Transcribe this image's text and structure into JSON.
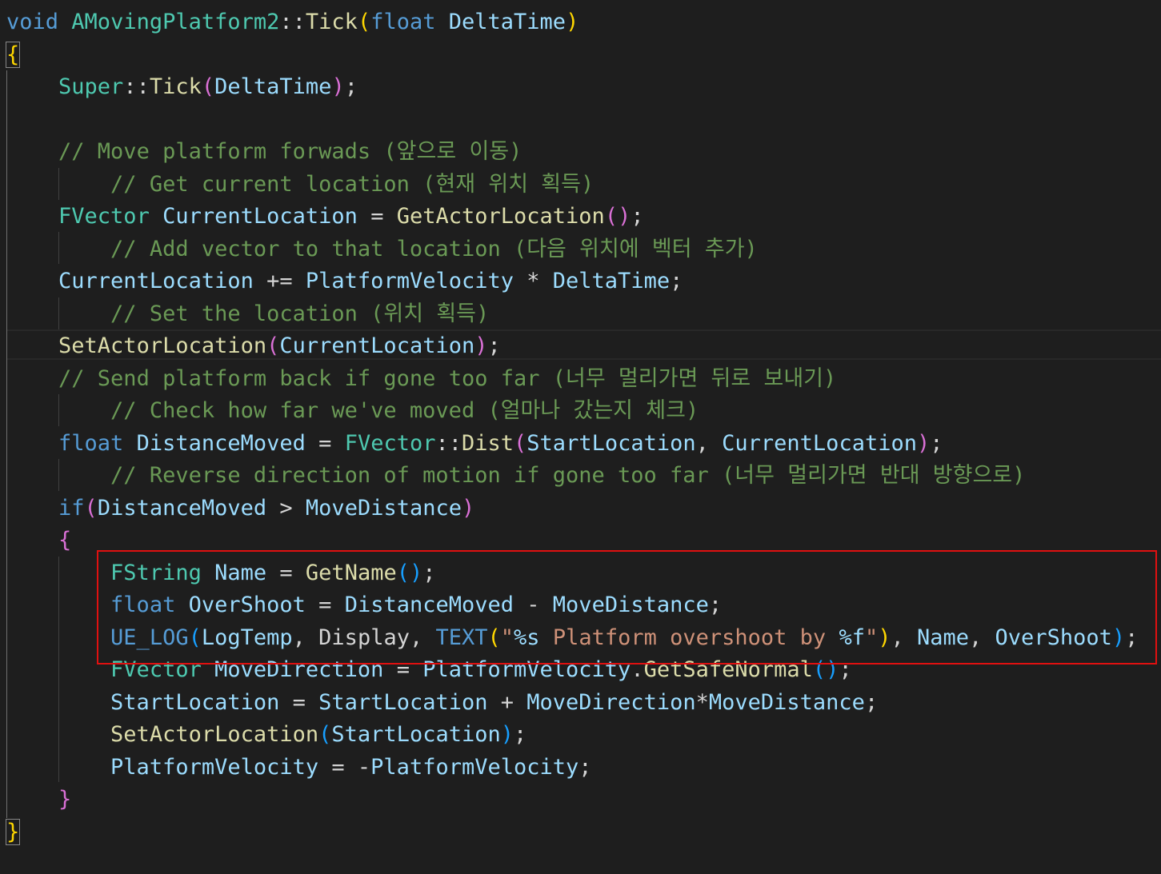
{
  "colors": {
    "background": "#1e1e1e",
    "keyword": "#569cd6",
    "type": "#4ec9b0",
    "function": "#dcdcaa",
    "variable": "#9cdcfe",
    "comment": "#6a9955",
    "string": "#ce9178",
    "macro": "#569cd6",
    "plain": "#d4d4d4",
    "bracket1": "#ffd700",
    "bracket2": "#da70d6",
    "bracket3": "#179fff",
    "highlight": "#e01010"
  },
  "code_lines": [
    [
      {
        "t": "void",
        "c": "keyword"
      },
      {
        "t": " ",
        "c": "plain"
      },
      {
        "t": "AMovingPlatform2",
        "c": "type"
      },
      {
        "t": "::",
        "c": "plain"
      },
      {
        "t": "Tick",
        "c": "function"
      },
      {
        "t": "(",
        "c": "bracket1"
      },
      {
        "t": "float",
        "c": "keyword"
      },
      {
        "t": " ",
        "c": "plain"
      },
      {
        "t": "DeltaTime",
        "c": "variable"
      },
      {
        "t": ")",
        "c": "bracket1"
      }
    ],
    [
      {
        "t": "{",
        "c": "bracket1",
        "box": true
      }
    ],
    [
      {
        "t": "    ",
        "c": "plain"
      },
      {
        "t": "Super",
        "c": "type"
      },
      {
        "t": "::",
        "c": "plain"
      },
      {
        "t": "Tick",
        "c": "function"
      },
      {
        "t": "(",
        "c": "bracket2"
      },
      {
        "t": "DeltaTime",
        "c": "variable"
      },
      {
        "t": ")",
        "c": "bracket2"
      },
      {
        "t": ";",
        "c": "plain"
      }
    ],
    [],
    [
      {
        "t": "    ",
        "c": "plain"
      },
      {
        "t": "// Move platform forwads (앞으로 이동)",
        "c": "comment"
      }
    ],
    [
      {
        "t": "        ",
        "c": "plain"
      },
      {
        "t": "// Get current location (현재 위치 획득)",
        "c": "comment"
      }
    ],
    [
      {
        "t": "    ",
        "c": "plain"
      },
      {
        "t": "FVector",
        "c": "type"
      },
      {
        "t": " ",
        "c": "plain"
      },
      {
        "t": "CurrentLocation",
        "c": "variable"
      },
      {
        "t": " = ",
        "c": "plain"
      },
      {
        "t": "GetActorLocation",
        "c": "function"
      },
      {
        "t": "(",
        "c": "bracket2"
      },
      {
        "t": ")",
        "c": "bracket2"
      },
      {
        "t": ";",
        "c": "plain"
      }
    ],
    [
      {
        "t": "        ",
        "c": "plain"
      },
      {
        "t": "// Add vector to that location (다음 위치에 벡터 추가)",
        "c": "comment"
      }
    ],
    [
      {
        "t": "    ",
        "c": "plain"
      },
      {
        "t": "CurrentLocation",
        "c": "variable"
      },
      {
        "t": " += ",
        "c": "plain"
      },
      {
        "t": "PlatformVelocity",
        "c": "variable"
      },
      {
        "t": " * ",
        "c": "plain"
      },
      {
        "t": "DeltaTime",
        "c": "variable"
      },
      {
        "t": ";",
        "c": "plain"
      }
    ],
    [
      {
        "t": "        ",
        "c": "plain"
      },
      {
        "t": "// Set the location (위치 획득)",
        "c": "comment"
      }
    ],
    [
      {
        "t": "    ",
        "c": "plain"
      },
      {
        "t": "SetActorLocation",
        "c": "function"
      },
      {
        "t": "(",
        "c": "bracket2"
      },
      {
        "t": "CurrentLocation",
        "c": "variable"
      },
      {
        "t": ")",
        "c": "bracket2"
      },
      {
        "t": ";",
        "c": "plain"
      }
    ],
    [
      {
        "t": "    ",
        "c": "plain"
      },
      {
        "t": "// Send platform back if gone too far (너무 멀리가면 뒤로 보내기)",
        "c": "comment"
      }
    ],
    [
      {
        "t": "        ",
        "c": "plain"
      },
      {
        "t": "// Check how far we've moved (얼마나 갔는지 체크)",
        "c": "comment"
      }
    ],
    [
      {
        "t": "    ",
        "c": "plain"
      },
      {
        "t": "float",
        "c": "keyword"
      },
      {
        "t": " ",
        "c": "plain"
      },
      {
        "t": "DistanceMoved",
        "c": "variable"
      },
      {
        "t": " = ",
        "c": "plain"
      },
      {
        "t": "FVector",
        "c": "type"
      },
      {
        "t": "::",
        "c": "plain"
      },
      {
        "t": "Dist",
        "c": "function"
      },
      {
        "t": "(",
        "c": "bracket2"
      },
      {
        "t": "StartLocation",
        "c": "variable"
      },
      {
        "t": ", ",
        "c": "plain"
      },
      {
        "t": "CurrentLocation",
        "c": "variable"
      },
      {
        "t": ")",
        "c": "bracket2"
      },
      {
        "t": ";",
        "c": "plain"
      }
    ],
    [
      {
        "t": "        ",
        "c": "plain"
      },
      {
        "t": "// Reverse direction of motion if gone too far (너무 멀리가면 반대 방향으로)",
        "c": "comment"
      }
    ],
    [
      {
        "t": "    ",
        "c": "plain"
      },
      {
        "t": "if",
        "c": "keyword"
      },
      {
        "t": "(",
        "c": "bracket2"
      },
      {
        "t": "DistanceMoved",
        "c": "variable"
      },
      {
        "t": " > ",
        "c": "plain"
      },
      {
        "t": "MoveDistance",
        "c": "variable"
      },
      {
        "t": ")",
        "c": "bracket2"
      }
    ],
    [
      {
        "t": "    ",
        "c": "plain"
      },
      {
        "t": "{",
        "c": "bracket2"
      }
    ],
    [
      {
        "t": "        ",
        "c": "plain"
      },
      {
        "t": "FString",
        "c": "type"
      },
      {
        "t": " ",
        "c": "plain"
      },
      {
        "t": "Name",
        "c": "variable"
      },
      {
        "t": " = ",
        "c": "plain"
      },
      {
        "t": "GetName",
        "c": "function"
      },
      {
        "t": "(",
        "c": "bracket3"
      },
      {
        "t": ")",
        "c": "bracket3"
      },
      {
        "t": ";",
        "c": "plain"
      }
    ],
    [
      {
        "t": "        ",
        "c": "plain"
      },
      {
        "t": "float",
        "c": "keyword"
      },
      {
        "t": " ",
        "c": "plain"
      },
      {
        "t": "OverShoot",
        "c": "variable"
      },
      {
        "t": " = ",
        "c": "plain"
      },
      {
        "t": "DistanceMoved",
        "c": "variable"
      },
      {
        "t": " - ",
        "c": "plain"
      },
      {
        "t": "MoveDistance",
        "c": "variable"
      },
      {
        "t": ";",
        "c": "plain"
      }
    ],
    [
      {
        "t": "        ",
        "c": "plain"
      },
      {
        "t": "UE_LOG",
        "c": "macro"
      },
      {
        "t": "(",
        "c": "bracket3"
      },
      {
        "t": "LogTemp",
        "c": "variable"
      },
      {
        "t": ", ",
        "c": "plain"
      },
      {
        "t": "Display",
        "c": "plain"
      },
      {
        "t": ", ",
        "c": "plain"
      },
      {
        "t": "TEXT",
        "c": "macro"
      },
      {
        "t": "(",
        "c": "bracket1"
      },
      {
        "t": "\"",
        "c": "string"
      },
      {
        "t": "%s",
        "c": "variable"
      },
      {
        "t": " Platform overshoot by ",
        "c": "string"
      },
      {
        "t": "%f",
        "c": "variable"
      },
      {
        "t": "\"",
        "c": "string"
      },
      {
        "t": ")",
        "c": "bracket1"
      },
      {
        "t": ", ",
        "c": "plain"
      },
      {
        "t": "Name",
        "c": "variable"
      },
      {
        "t": ", ",
        "c": "plain"
      },
      {
        "t": "OverShoot",
        "c": "variable"
      },
      {
        "t": ")",
        "c": "bracket3"
      },
      {
        "t": ";",
        "c": "plain"
      }
    ],
    [
      {
        "t": "        ",
        "c": "plain"
      },
      {
        "t": "FVector",
        "c": "type"
      },
      {
        "t": " ",
        "c": "plain"
      },
      {
        "t": "MoveDirection",
        "c": "variable"
      },
      {
        "t": " = ",
        "c": "plain"
      },
      {
        "t": "PlatformVelocity",
        "c": "variable"
      },
      {
        "t": ".",
        "c": "plain"
      },
      {
        "t": "GetSafeNormal",
        "c": "function"
      },
      {
        "t": "(",
        "c": "bracket3"
      },
      {
        "t": ")",
        "c": "bracket3"
      },
      {
        "t": ";",
        "c": "plain"
      }
    ],
    [
      {
        "t": "        ",
        "c": "plain"
      },
      {
        "t": "StartLocation",
        "c": "variable"
      },
      {
        "t": " = ",
        "c": "plain"
      },
      {
        "t": "StartLocation",
        "c": "variable"
      },
      {
        "t": " + ",
        "c": "plain"
      },
      {
        "t": "MoveDirection",
        "c": "variable"
      },
      {
        "t": "*",
        "c": "plain"
      },
      {
        "t": "MoveDistance",
        "c": "variable"
      },
      {
        "t": ";",
        "c": "plain"
      }
    ],
    [
      {
        "t": "        ",
        "c": "plain"
      },
      {
        "t": "SetActorLocation",
        "c": "function"
      },
      {
        "t": "(",
        "c": "bracket3"
      },
      {
        "t": "StartLocation",
        "c": "variable"
      },
      {
        "t": ")",
        "c": "bracket3"
      },
      {
        "t": ";",
        "c": "plain"
      }
    ],
    [
      {
        "t": "        ",
        "c": "plain"
      },
      {
        "t": "PlatformVelocity",
        "c": "variable"
      },
      {
        "t": " = -",
        "c": "plain"
      },
      {
        "t": "PlatformVelocity",
        "c": "variable"
      },
      {
        "t": ";",
        "c": "plain"
      }
    ],
    [
      {
        "t": "    ",
        "c": "plain"
      },
      {
        "t": "}",
        "c": "bracket2"
      }
    ],
    [
      {
        "t": "}",
        "c": "bracket1",
        "box": true
      }
    ]
  ]
}
